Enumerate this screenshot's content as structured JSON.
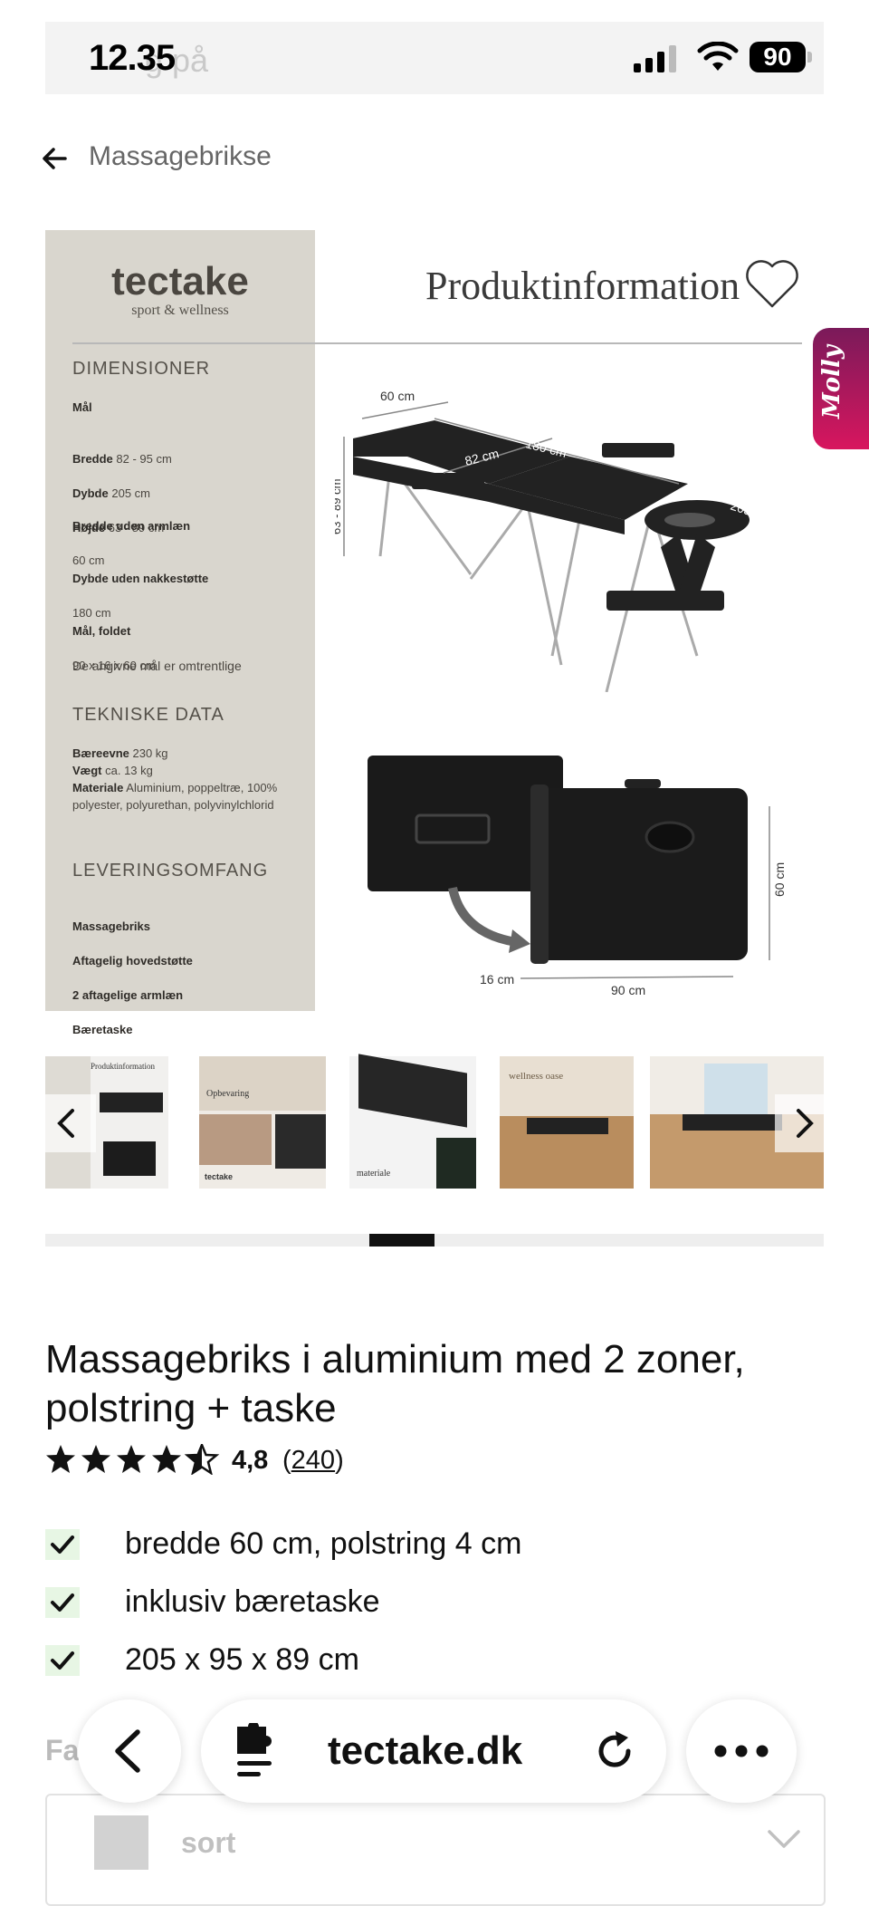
{
  "status_bar": {
    "time": "12.35",
    "ghost_text": "g på",
    "battery": "90"
  },
  "breadcrumb": {
    "label": "Massagebrikse"
  },
  "product_image": {
    "brand": "tectake",
    "brand_sub": "sport & wellness",
    "heading": "Produktinformation",
    "sections": [
      {
        "title": "DIMENSIONER"
      },
      {
        "title": "TEKNISKE DATA"
      },
      {
        "title": "LEVERINGSOMFANG"
      }
    ],
    "dims": {
      "maal": "Mål",
      "bredde_label": "Bredde",
      "bredde": "82 - 95 cm",
      "dybde_label": "Dybde",
      "dybde": "205 cm",
      "hojde_label": "Højde",
      "hojde": "63 - 89 cm",
      "armlaen_label": "Bredde uden armlæn",
      "armlaen": "60 cm",
      "nakke_label": "Dybde uden nakkestøtte",
      "nakke": "180 cm",
      "foldet_label": "Mål, foldet",
      "foldet": "90 x 16 x 60 cm",
      "note": "De angivne mål er omtrentlige"
    },
    "tech": {
      "baereevne_label": "Bæreevne",
      "baereevne": "230 kg",
      "vaegt_label": "Vægt",
      "vaegt": "ca. 13 kg",
      "materiale_label": "Materiale",
      "materiale": "Aluminium, poppeltræ, 100% polyester, polyurethan, polyvinylchlorid"
    },
    "delivery": [
      "Massagebriks",
      "Aftagelig hovedstøtte",
      "2 aftagelige armlæn",
      "Bæretaske"
    ],
    "dimension_labels": {
      "width_top": "60 cm",
      "length": "180 cm",
      "inner": "82 cm",
      "total": "205 cm",
      "height": "63 - 89 cm",
      "case_depth": "16 cm",
      "case_width": "90 cm",
      "case_height": "60 cm"
    }
  },
  "thumbnails": {
    "items": [
      {
        "caption": "Produktinformation"
      },
      {
        "caption": "Opbevaring"
      },
      {
        "caption": "materiale"
      },
      {
        "caption": "wellness oase"
      },
      {
        "caption": ""
      }
    ],
    "thumb_brand": "tectake"
  },
  "product": {
    "title": "Massagebriks i aluminium med 2 zoner, polstring + taske",
    "rating_value": 4.8,
    "rating": "4,8",
    "review_count": "240",
    "features": [
      "bredde 60 cm, polstring 4 cm",
      "inklusiv bæretaske",
      "205 x 95 x 89 cm"
    ]
  },
  "variant": {
    "label": "Fa",
    "selected": "sort"
  },
  "browser": {
    "domain": "tectake.dk"
  },
  "widget": {
    "label": "Molly"
  },
  "colors": {
    "check_bg": "#e7f6e4",
    "panel_bg": "#d9d6ce",
    "molly_from": "#7a1a5a",
    "molly_to": "#d8165e"
  }
}
